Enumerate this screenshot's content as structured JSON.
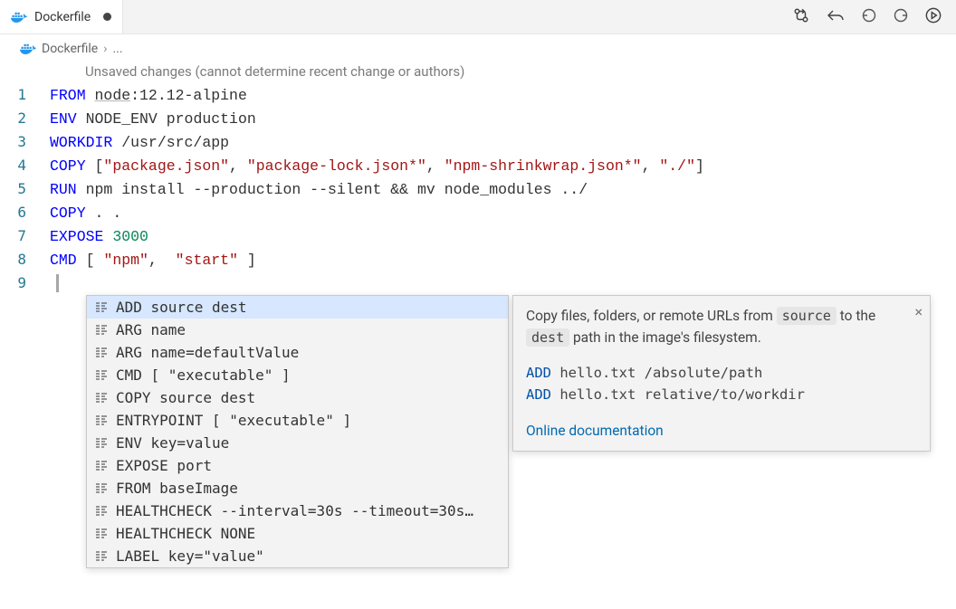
{
  "tab": {
    "label": "Dockerfile"
  },
  "breadcrumb": {
    "file": "Dockerfile",
    "more": "..."
  },
  "gutter_message": "Unsaved changes (cannot determine recent change or authors)",
  "lines": {
    "l1": {
      "no": "1",
      "kw": "FROM",
      "img": "node",
      "rest": ":12.12-alpine"
    },
    "l2": {
      "no": "2",
      "kw": "ENV",
      "rest": "NODE_ENV production"
    },
    "l3": {
      "no": "3",
      "kw": "WORKDIR",
      "rest": "/usr/src/app"
    },
    "l4": {
      "no": "4",
      "kw": "COPY",
      "s1": "\"package.json\"",
      "s2": "\"package-lock.json*\"",
      "s3": "\"npm-shrinkwrap.json*\"",
      "s4": "\"./\""
    },
    "l5": {
      "no": "5",
      "kw": "RUN",
      "rest": "npm install --production --silent && mv node_modules ../"
    },
    "l6": {
      "no": "6",
      "kw": "COPY",
      "rest": ". ."
    },
    "l7": {
      "no": "7",
      "kw": "EXPOSE",
      "num": "3000"
    },
    "l8": {
      "no": "8",
      "kw": "CMD",
      "s1": "\"npm\"",
      "s2": "\"start\""
    },
    "l9": {
      "no": "9"
    }
  },
  "autocomplete": {
    "items": [
      "ADD source dest",
      "ARG name",
      "ARG name=defaultValue",
      "CMD [ \"executable\" ]",
      "COPY source dest",
      "ENTRYPOINT [ \"executable\" ]",
      "ENV key=value",
      "EXPOSE port",
      "FROM baseImage",
      "HEALTHCHECK --interval=30s --timeout=30s…",
      "HEALTHCHECK NONE",
      "LABEL key=\"value\""
    ],
    "doc": {
      "pre1": "Copy files, folders, or remote URLs from ",
      "code1": "source",
      "mid": " to the ",
      "code2": "dest",
      "post": " path in the image's filesystem.",
      "ex1_kw": "ADD",
      "ex1_rest": " hello.txt /absolute/path",
      "ex2_kw": "ADD",
      "ex2_rest": " hello.txt relative/to/workdir",
      "link": "Online documentation"
    }
  }
}
